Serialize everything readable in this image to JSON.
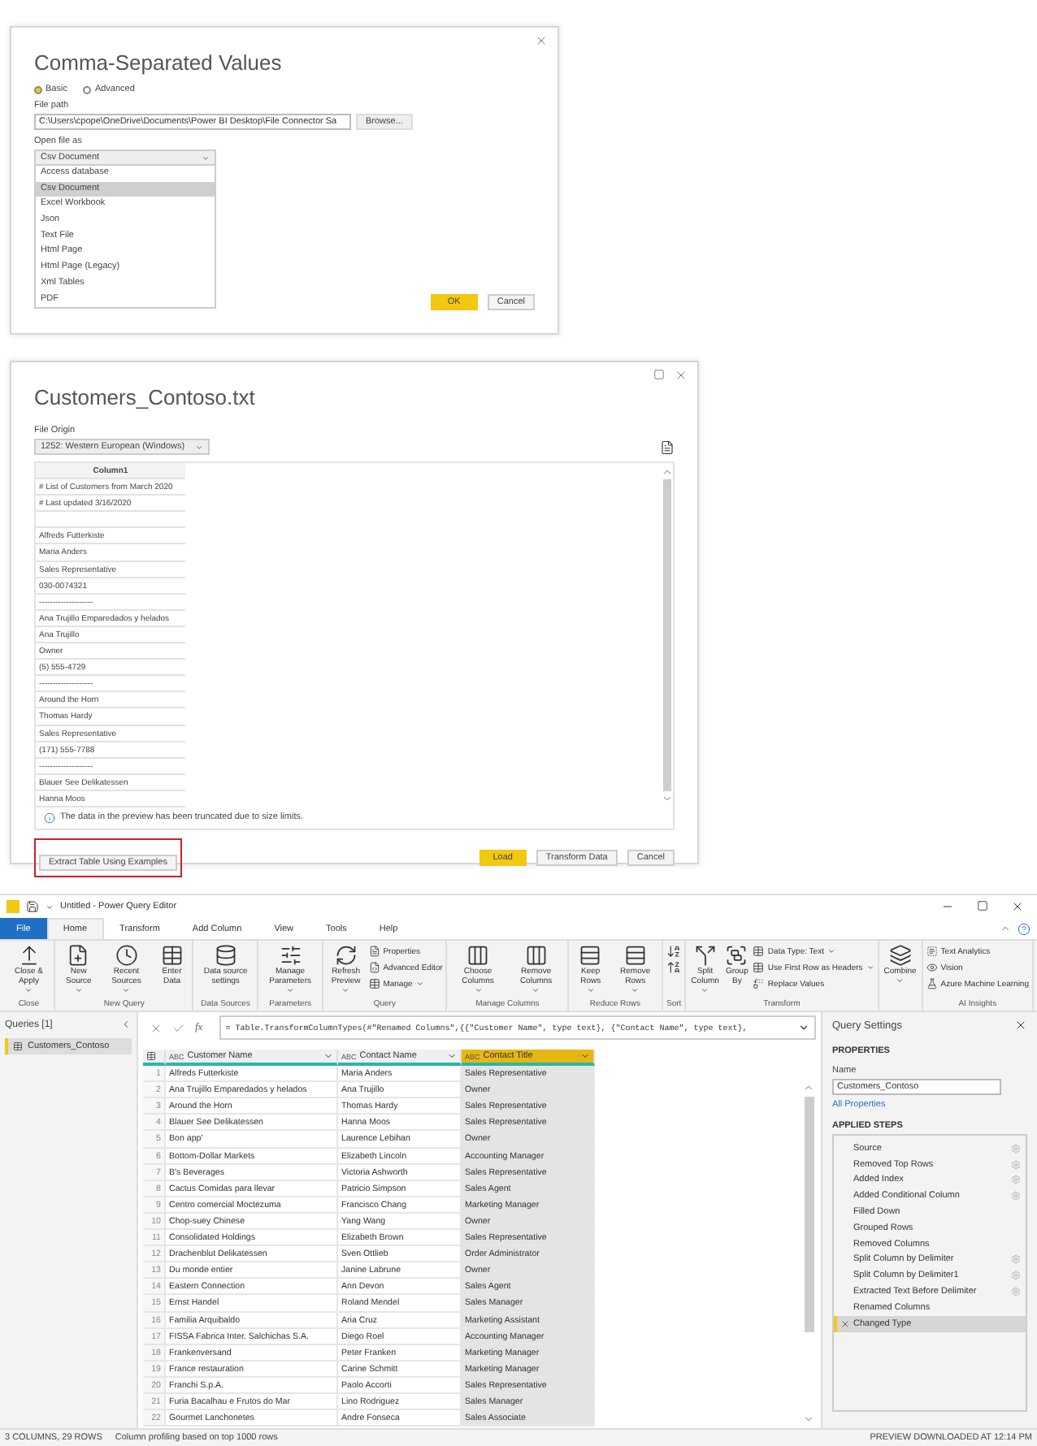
{
  "csv_dialog": {
    "title": "Comma-Separated Values",
    "modes": [
      {
        "label": "Basic",
        "selected": true
      },
      {
        "label": "Advanced",
        "selected": false
      }
    ],
    "file_path": {
      "label": "File path",
      "value": "C:\\Users\\cpope\\OneDrive\\Documents\\Power BI Desktop\\File Connector Sa",
      "button": "Browse..."
    },
    "open_file_as": {
      "label": "Open file as",
      "value": "Csv Document",
      "options": [
        {
          "label": "Access database",
          "selected": false
        },
        {
          "label": "Csv Document",
          "selected": true
        },
        {
          "label": "Excel Workbook",
          "selected": false
        },
        {
          "label": "Json",
          "selected": false
        },
        {
          "label": "Text File",
          "selected": false
        },
        {
          "label": "Html Page",
          "selected": false
        },
        {
          "label": "Html Page (Legacy)",
          "selected": false
        },
        {
          "label": "Xml Tables",
          "selected": false
        },
        {
          "label": "PDF",
          "selected": false
        }
      ]
    },
    "buttons": [
      {
        "label": "OK",
        "kind": "primary"
      },
      {
        "label": "Cancel",
        "kind": "secondary"
      }
    ]
  },
  "preview_dialog": {
    "title": "Customers_Contoso.txt",
    "file_origin": {
      "label": "File Origin",
      "value": "1252: Western European (Windows)"
    },
    "table": {
      "columns": [
        "Column1"
      ],
      "rows": [
        "# List of Customers from March 2020",
        "# Last updated 3/16/2020",
        null,
        "Alfreds Futterkiste",
        "Maria Anders",
        "Sales Representative",
        "030-0074321",
        "--------------------",
        "Ana Trujillo Emparedados y helados",
        "Ana Trujillo",
        "Owner",
        "(5) 555-4729",
        "--------------------",
        "Around the Horn",
        "Thomas Hardy",
        "Sales Representative",
        "(171) 555-7788",
        "--------------------",
        "Blauer See Delikatessen",
        "Hanna Moos"
      ]
    },
    "notice": "The data in the preview has been truncated due to size limits.",
    "buttons": [
      {
        "label": "Extract Table Using Examples",
        "kind": "secondary",
        "highlighted": true
      },
      {
        "label": "Load",
        "kind": "primary",
        "highlighted": false
      },
      {
        "label": "Transform Data",
        "kind": "secondary",
        "highlighted": false
      },
      {
        "label": "Cancel",
        "kind": "secondary",
        "highlighted": false
      }
    ]
  },
  "editor": {
    "window_title": "Untitled - Power Query Editor",
    "tabs": [
      {
        "label": "File",
        "kind": "file",
        "selected": false
      },
      {
        "label": "Home",
        "kind": "tab",
        "selected": true
      },
      {
        "label": "Transform",
        "kind": "tab",
        "selected": false
      },
      {
        "label": "Add Column",
        "kind": "tab",
        "selected": false
      },
      {
        "label": "View",
        "kind": "tab",
        "selected": false
      },
      {
        "label": "Tools",
        "kind": "tab",
        "selected": false
      },
      {
        "label": "Help",
        "kind": "tab",
        "selected": false
      }
    ],
    "ribbon": [
      {
        "label": "Close",
        "items": [
          {
            "label": "Close & Apply",
            "kind": "large",
            "dropdown": true
          }
        ]
      },
      {
        "label": "New Query",
        "items": [
          {
            "label": "New Source",
            "kind": "large",
            "dropdown": true
          },
          {
            "label": "Recent Sources",
            "kind": "large",
            "dropdown": true
          },
          {
            "label": "Enter Data",
            "kind": "large",
            "dropdown": false
          }
        ]
      },
      {
        "label": "Data Sources",
        "items": [
          {
            "label": "Data source settings",
            "kind": "large",
            "dropdown": false
          }
        ]
      },
      {
        "label": "Parameters",
        "items": [
          {
            "label": "Manage Parameters",
            "kind": "large",
            "dropdown": true
          }
        ]
      },
      {
        "label": "Query",
        "items": [
          {
            "label": "Refresh Preview",
            "kind": "large",
            "dropdown": true
          },
          {
            "label": "Properties",
            "kind": "small",
            "dropdown": false
          },
          {
            "label": "Advanced Editor",
            "kind": "small",
            "dropdown": false
          },
          {
            "label": "Manage",
            "kind": "small",
            "dropdown": true
          }
        ]
      },
      {
        "label": "Manage Columns",
        "items": [
          {
            "label": "Choose Columns",
            "kind": "large",
            "dropdown": true
          },
          {
            "label": "Remove Columns",
            "kind": "large",
            "dropdown": true
          }
        ]
      },
      {
        "label": "Reduce Rows",
        "items": [
          {
            "label": "Keep Rows",
            "kind": "large",
            "dropdown": true
          },
          {
            "label": "Remove Rows",
            "kind": "large",
            "dropdown": true
          }
        ]
      },
      {
        "label": "Sort",
        "items": [
          {
            "kind": "icon"
          },
          {
            "kind": "icon"
          }
        ]
      },
      {
        "label": "Transform",
        "items": [
          {
            "label": "Split Column",
            "kind": "large",
            "dropdown": true
          },
          {
            "label": "Group By",
            "kind": "large",
            "dropdown": false
          },
          {
            "label": "Data Type: Text",
            "kind": "small",
            "dropdown": true
          },
          {
            "label": "Use First Row as Headers",
            "kind": "small",
            "dropdown": true
          },
          {
            "label": "Replace Values",
            "kind": "small",
            "dropdown": false
          }
        ]
      },
      {
        "items": [
          {
            "label": "Combine",
            "kind": "large",
            "dropdown": true
          }
        ]
      },
      {
        "label": "AI Insights",
        "items": [
          {
            "label": "Text Analytics",
            "kind": "small",
            "dropdown": false
          },
          {
            "label": "Vision",
            "kind": "small",
            "dropdown": false
          },
          {
            "label": "Azure Machine Learning",
            "kind": "small",
            "dropdown": false
          }
        ]
      }
    ],
    "queries": {
      "title": "Queries [1]",
      "items": [
        {
          "label": "Customers_Contoso",
          "selected": true
        }
      ]
    },
    "formula_bar": {
      "fx": "fx",
      "formula": "= Table.TransformColumnTypes(#\"Renamed Columns\",{{\"Customer Name\", type text}, {\"Contact Name\", type text},"
    },
    "table": {
      "columns": [
        {
          "label": "Customer Name",
          "type": "ABC",
          "selected": false
        },
        {
          "label": "Contact Name",
          "type": "ABC",
          "selected": false
        },
        {
          "label": "Contact Title",
          "type": "ABC",
          "selected": true
        }
      ],
      "rows": [
        {
          "number": "1",
          "cells": [
            "Alfreds Futterkiste",
            "Maria Anders",
            "Sales Representative"
          ]
        },
        {
          "number": "2",
          "cells": [
            "Ana Trujillo Emparedados y helados",
            "Ana Trujillo",
            "Owner"
          ]
        },
        {
          "number": "3",
          "cells": [
            "Around the Horn",
            "Thomas Hardy",
            "Sales Representative"
          ]
        },
        {
          "number": "4",
          "cells": [
            "Blauer See Delikatessen",
            "Hanna Moos",
            "Sales Representative"
          ]
        },
        {
          "number": "5",
          "cells": [
            "Bon app'",
            "Laurence Lebihan",
            "Owner"
          ]
        },
        {
          "number": "6",
          "cells": [
            "Bottom-Dollar Markets",
            "Elizabeth Lincoln",
            "Accounting Manager"
          ]
        },
        {
          "number": "7",
          "cells": [
            "B's Beverages",
            "Victoria Ashworth",
            "Sales Representative"
          ]
        },
        {
          "number": "8",
          "cells": [
            "Cactus Comidas para llevar",
            "Patricio Simpson",
            "Sales Agent"
          ]
        },
        {
          "number": "9",
          "cells": [
            "Centro comercial Moctezuma",
            "Francisco Chang",
            "Marketing Manager"
          ]
        },
        {
          "number": "10",
          "cells": [
            "Chop-suey Chinese",
            "Yang Wang",
            "Owner"
          ]
        },
        {
          "number": "11",
          "cells": [
            "Consolidated Holdings",
            "Elizabeth Brown",
            "Sales Representative"
          ]
        },
        {
          "number": "12",
          "cells": [
            "Drachenblut Delikatessen",
            "Sven Ottlieb",
            "Order Administrator"
          ]
        },
        {
          "number": "13",
          "cells": [
            "Du monde entier",
            "Janine Labrune",
            "Owner"
          ]
        },
        {
          "number": "14",
          "cells": [
            "Eastern Connection",
            "Ann Devon",
            "Sales Agent"
          ]
        },
        {
          "number": "15",
          "cells": [
            "Ernst Handel",
            "Roland Mendel",
            "Sales Manager"
          ]
        },
        {
          "number": "16",
          "cells": [
            "Familia Arquibaldo",
            "Aria Cruz",
            "Marketing Assistant"
          ]
        },
        {
          "number": "17",
          "cells": [
            "FISSA Fabrica Inter. Salchichas S.A.",
            "Diego Roel",
            "Accounting Manager"
          ]
        },
        {
          "number": "18",
          "cells": [
            "Frankenversand",
            "Peter Franken",
            "Marketing Manager"
          ]
        },
        {
          "number": "19",
          "cells": [
            "France restauration",
            "Carine Schmitt",
            "Marketing Manager"
          ]
        },
        {
          "number": "20",
          "cells": [
            "Franchi S.p.A.",
            "Paolo Accorti",
            "Sales Representative"
          ]
        },
        {
          "number": "21",
          "cells": [
            "Furia Bacalhau e Frutos do Mar",
            "Lino Rodriguez",
            "Sales Manager"
          ]
        },
        {
          "number": "22",
          "cells": [
            "Gourmet Lanchonetes",
            "Andre Fonseca",
            "Sales Associate"
          ]
        }
      ]
    },
    "query_settings": {
      "title": "Query Settings",
      "properties_heading": "PROPERTIES",
      "name_label": "Name",
      "name_value": "Customers_Contoso",
      "all_properties": "All Properties",
      "steps_heading": "APPLIED STEPS",
      "steps": [
        {
          "label": "Source",
          "settings": true,
          "selected": false
        },
        {
          "label": "Removed Top Rows",
          "settings": true,
          "selected": false
        },
        {
          "label": "Added Index",
          "settings": true,
          "selected": false
        },
        {
          "label": "Added Conditional Column",
          "settings": true,
          "selected": false
        },
        {
          "label": "Filled Down",
          "settings": false,
          "selected": false
        },
        {
          "label": "Grouped Rows",
          "settings": false,
          "selected": false
        },
        {
          "label": "Removed Columns",
          "settings": false,
          "selected": false
        },
        {
          "label": "Split Column by Delimiter",
          "settings": true,
          "selected": false
        },
        {
          "label": "Split Column by Delimiter1",
          "settings": true,
          "selected": false
        },
        {
          "label": "Extracted Text Before Delimiter",
          "settings": true,
          "selected": false
        },
        {
          "label": "Renamed Columns",
          "settings": false,
          "selected": false
        },
        {
          "label": "Changed Type",
          "settings": false,
          "selected": true
        }
      ]
    },
    "status_bar": {
      "items": [
        "3 COLUMNS, 29 ROWS",
        "Column profiling based on top 1000 rows"
      ],
      "right": "PREVIEW DOWNLOADED AT 12:14 PM"
    }
  }
}
